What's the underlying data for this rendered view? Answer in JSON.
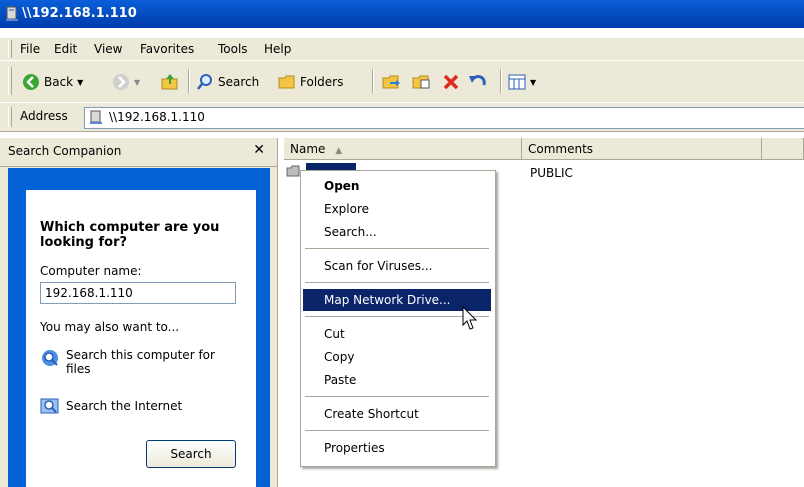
{
  "window": {
    "title": "\\\\192.168.1.110"
  },
  "menubar": {
    "items": [
      "File",
      "Edit",
      "View",
      "Favorites",
      "Tools",
      "Help"
    ]
  },
  "toolbar": {
    "back_label": "Back",
    "search_label": "Search",
    "folders_label": "Folders"
  },
  "address": {
    "label": "Address",
    "value": "\\\\192.168.1.110"
  },
  "search_companion": {
    "title": "Search Companion",
    "heading": "Which computer are you looking for?",
    "computer_name_label": "Computer name:",
    "computer_name_value": "192.168.1.110",
    "also_label": "You may also want to...",
    "link_search_computer": "Search this computer for files",
    "link_search_internet": "Search the Internet",
    "search_button": "Search"
  },
  "listview": {
    "columns": [
      "Name",
      "Comments"
    ],
    "rows": [
      {
        "comment": "PUBLIC"
      }
    ]
  },
  "context_menu": {
    "items": [
      "Open",
      "Explore",
      "Search...",
      "Scan for Viruses...",
      "Map Network Drive...",
      "Cut",
      "Copy",
      "Paste",
      "Create Shortcut",
      "Properties"
    ],
    "highlighted": "Map Network Drive..."
  },
  "colors": {
    "selection": "#0a246a",
    "titlebar": "#0a5fd8",
    "companion_blue": "#0561d6",
    "chrome": "#ece9d8"
  }
}
